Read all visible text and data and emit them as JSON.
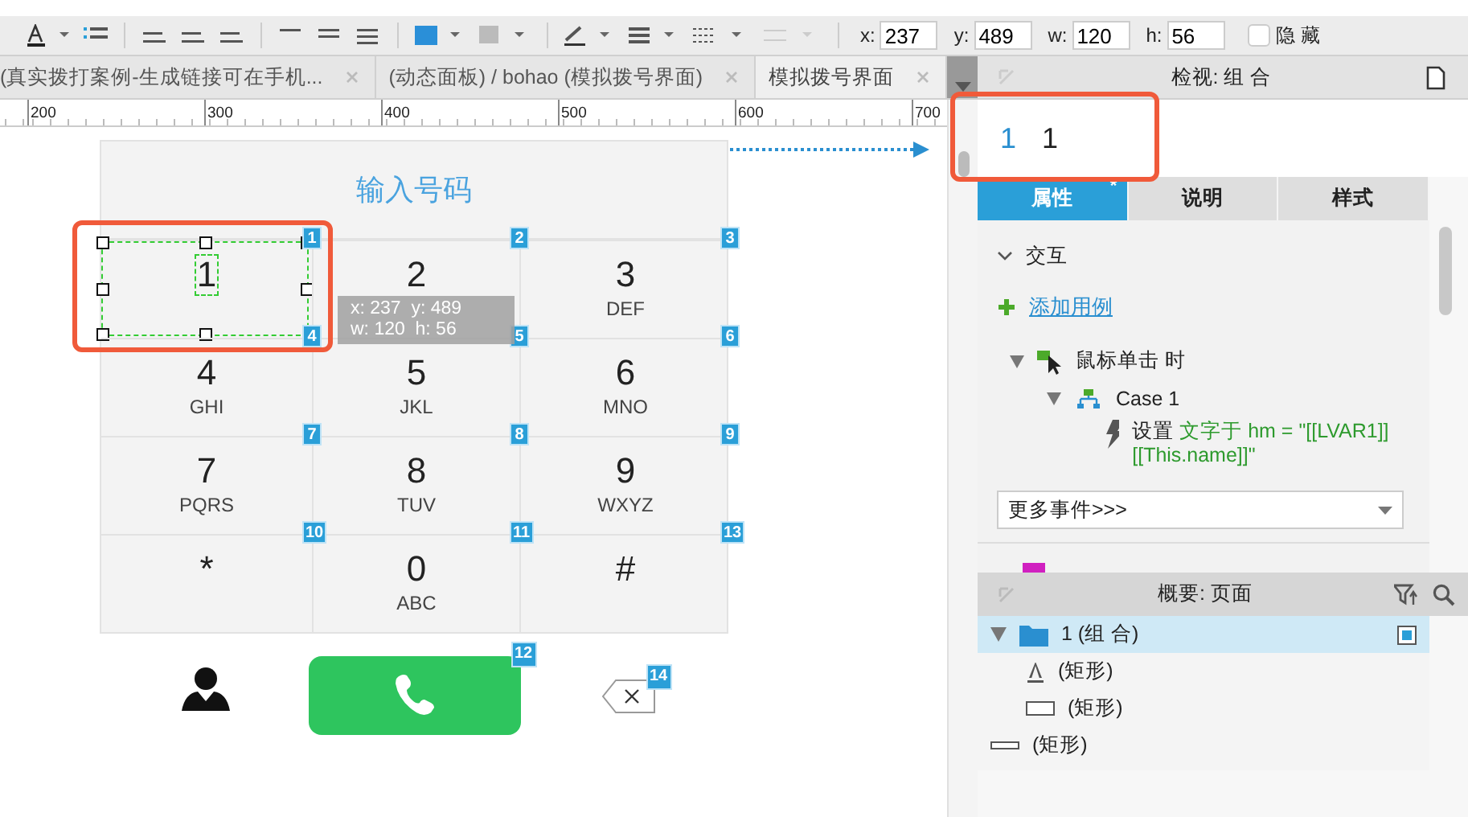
{
  "toolbar": {
    "fields": [
      {
        "label": "x:",
        "value": "237"
      },
      {
        "label": "y:",
        "value": "489"
      },
      {
        "label": "w:",
        "value": "120"
      },
      {
        "label": "h:",
        "value": "56"
      }
    ],
    "hide_checkbox": {
      "label": "隐 藏",
      "checked": false
    }
  },
  "doc_tabs": [
    {
      "label": "(真实拨打案例-生成链接可在手机...",
      "selected": false
    },
    {
      "label": "(动态面板) / bohao (模拟拨号界面)",
      "selected": false
    },
    {
      "label": "模拟拨号界面",
      "selected": true
    }
  ],
  "ruler": {
    "labels": [
      "200",
      "300",
      "400",
      "500",
      "600",
      "700"
    ]
  },
  "canvas": {
    "title": "输入号码",
    "keys": [
      {
        "digit": "1",
        "selected": true,
        "badges": [
          "1",
          "4"
        ]
      },
      {
        "digit": "2",
        "selected": false,
        "badges": [
          "2",
          "5"
        ]
      },
      {
        "digit": "3",
        "letters": "DEF",
        "selected": false,
        "badges": [
          "3",
          "6"
        ]
      },
      {
        "digit": "4",
        "letters": "GHI",
        "selected": false,
        "badges": [
          "7"
        ]
      },
      {
        "digit": "5",
        "letters": "JKL",
        "selected": false,
        "badges": [
          "8"
        ]
      },
      {
        "digit": "6",
        "letters": "MNO",
        "selected": false,
        "badges": [
          "9"
        ]
      },
      {
        "digit": "7",
        "letters": "PQRS",
        "selected": false,
        "badges": [
          "10"
        ]
      },
      {
        "digit": "8",
        "letters": "TUV",
        "selected": false,
        "badges": [
          "11"
        ]
      },
      {
        "digit": "9",
        "letters": "WXYZ",
        "selected": false,
        "badges": [
          "13"
        ]
      },
      {
        "digit": "*",
        "selected": false
      },
      {
        "digit": "0",
        "letters": "ABC",
        "selected": false
      },
      {
        "digit": "#",
        "selected": false
      }
    ],
    "call_button": {
      "badge": "12"
    },
    "delete_button": {
      "badge": "14"
    },
    "tooltip": [
      "x: 237  y: 489",
      "w: 120  h: 56"
    ]
  },
  "inspector": {
    "title": "检视: 组 合",
    "name_row": {
      "index": "1",
      "name": "1"
    },
    "tabs": [
      {
        "label": "属性",
        "selected": true,
        "mark": "*"
      },
      {
        "label": "说明",
        "selected": false
      },
      {
        "label": "样式",
        "selected": false
      }
    ],
    "interactions": {
      "heading": "交互",
      "expanded": true,
      "add_link": "添加用例",
      "events": [
        {
          "label": "鼠标单击 时",
          "expanded": true,
          "cases": [
            {
              "label": "Case 1",
              "expanded": true,
              "actions": [
                {
                  "verb": "设置",
                  "detail": "文字于 hm = \"[[LVAR1]][[This.name]]\""
                }
              ]
            }
          ]
        }
      ],
      "more_events": "更多事件>>>"
    }
  },
  "outline": {
    "title": "概要: 页面",
    "items": [
      {
        "label": "1 (组 合)",
        "kind": "folder",
        "selected": true,
        "expanded": true,
        "children": [
          {
            "label": "(矩形)",
            "kind": "text",
            "selected": false
          },
          {
            "label": "(矩形)",
            "kind": "rect",
            "selected": false
          }
        ]
      },
      {
        "label": "(矩形)",
        "kind": "line",
        "selected": false
      }
    ]
  }
}
